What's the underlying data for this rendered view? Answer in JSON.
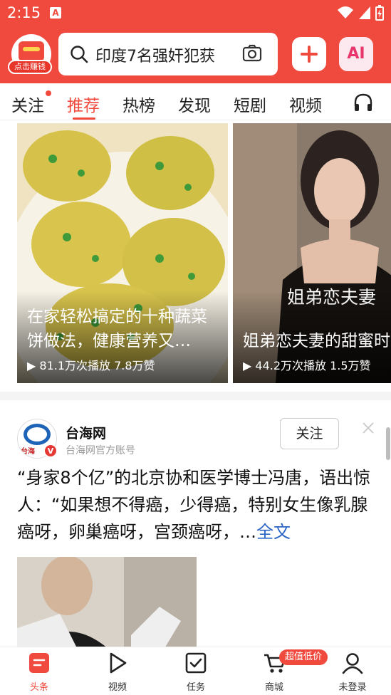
{
  "status_bar": {
    "time": "2:15",
    "notification_glyph": "A"
  },
  "header": {
    "logo_label": "点击赚钱",
    "search_text": "印度7名强奸犯获",
    "ai_label": "AI"
  },
  "tabs": [
    {
      "label": "关注",
      "has_dot": true
    },
    {
      "label": "推荐",
      "active": true
    },
    {
      "label": "热榜"
    },
    {
      "label": "发现"
    },
    {
      "label": "短剧"
    },
    {
      "label": "视频"
    }
  ],
  "cards": [
    {
      "title": "在家轻松搞定的十种蔬菜饼做法，健康营养又…",
      "stats": "▶ 81.1万次播放 7.8万赞"
    },
    {
      "overlay": "姐弟恋夫妻",
      "title": "姐弟恋夫妻的甜蜜时",
      "stats": "▶ 44.2万次播放 1.5万赞"
    }
  ],
  "article": {
    "author": "台海网",
    "author_sub": "台海网官方账号",
    "avatar_text": "台海",
    "verified": "V",
    "follow_label": "关注",
    "headline": "“身家8个亿”的北京协和医学博士冯唐，语出惊人：“如果想不得癌，少得癌，特别女生像乳腺癌呀，卵巢癌呀，宫颈癌呀，…",
    "more_label": "全文"
  },
  "bottom_nav": [
    {
      "label": "头条",
      "icon": "headline-icon",
      "active": true
    },
    {
      "label": "视频",
      "icon": "play-icon"
    },
    {
      "label": "任务",
      "icon": "task-icon"
    },
    {
      "label": "商城",
      "icon": "cart-icon"
    },
    {
      "label": "未登录",
      "icon": "user-icon"
    }
  ],
  "mall_badge": "超值低价",
  "colors": {
    "accent": "#f04a3e",
    "link": "#2d65c4"
  }
}
